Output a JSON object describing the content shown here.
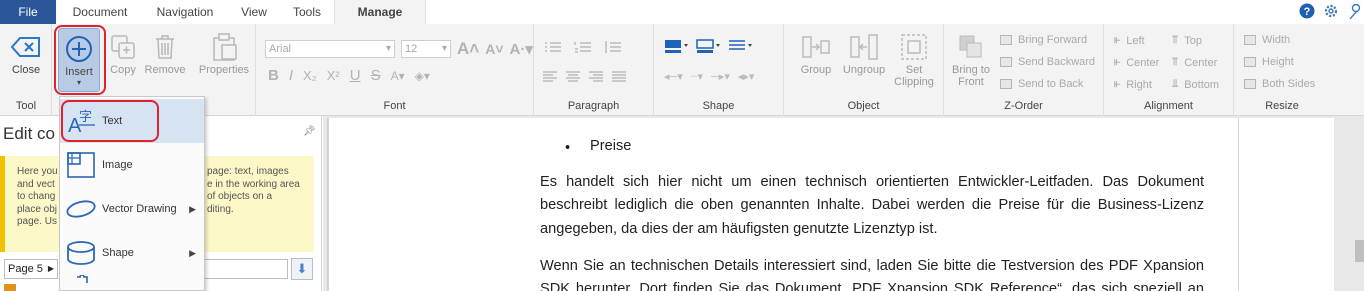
{
  "tabs": {
    "file": "File",
    "document": "Document",
    "navigation": "Navigation",
    "view": "View",
    "tools": "Tools",
    "manage": "Manage"
  },
  "ribbon": {
    "tool": {
      "close": "Close",
      "insert": "Insert",
      "copy": "Copy",
      "remove": "Remove",
      "label": "Tool"
    },
    "properties": "Properties",
    "font": {
      "family": "Arial",
      "size": "12",
      "label": "Font"
    },
    "paragraph": {
      "label": "Paragraph"
    },
    "shape": {
      "label": "Shape"
    },
    "object": {
      "group": "Group",
      "ungroup": "Ungroup",
      "set_clipping_1": "Set",
      "set_clipping_2": "Clipping",
      "label": "Object"
    },
    "zorder": {
      "bring_to_front_1": "Bring to",
      "bring_to_front_2": "Front",
      "bring_forward": "Bring Forward",
      "send_backward": "Send Backward",
      "send_to_back": "Send to Back",
      "label": "Z-Order"
    },
    "alignment": {
      "left": "Left",
      "center": "Center",
      "right": "Right",
      "top": "Top",
      "middle": "Center",
      "bottom": "Bottom",
      "label": "Alignment"
    },
    "resize": {
      "width": "Width",
      "height": "Height",
      "both": "Both Sides",
      "label": "Resize"
    }
  },
  "dropdown": {
    "items": [
      {
        "label": "Text",
        "icon": "text-icon"
      },
      {
        "label": "Image",
        "icon": "image-icon"
      },
      {
        "label": "Vector Drawing",
        "icon": "vector-drawing-icon"
      },
      {
        "label": "Shape",
        "icon": "shape-icon"
      }
    ]
  },
  "left_panel": {
    "title": "Edit co",
    "help": "Here you\nand vect\nto chang\nplace obj\npage. Us",
    "help_right": "page: text, images\ne in the working area\nof objects on a\nditing.",
    "page_select": "Page 5"
  },
  "document": {
    "bullet": "Preise",
    "para1": [
      "Es handelt sich hier nicht um einen technisch orientierten Entwickler-Leitfaden. Das Dokument",
      "beschreibt lediglich die oben genannten Inhalte. Dabei werden die Preise für die Business-Lizenz",
      "angegeben, da dies der am häufigsten genutzte Lizenztyp ist."
    ],
    "para2": [
      "Wenn Sie an technischen Details interessiert sind, laden Sie bitte die Testversion des PDF Xpansion",
      "SDK herunter. Dort finden Sie das Dokument „PDF Xpansion SDK Reference“, das sich speziell an"
    ]
  },
  "colors": {
    "file_tab": "#2b579a",
    "highlight": "#d6e3f3",
    "callout": "#e0222b",
    "note_bg": "#fdf8c8"
  }
}
